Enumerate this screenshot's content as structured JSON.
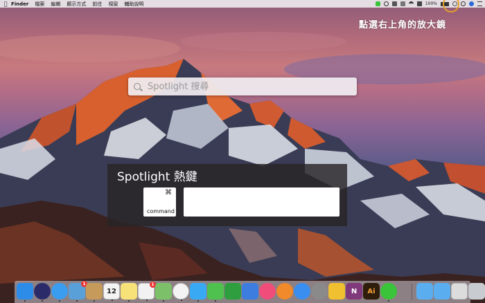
{
  "menubar": {
    "app_name": "Finder",
    "items": [
      "檔案",
      "編輯",
      "顯示方式",
      "前往",
      "視窗",
      "輔助說明"
    ],
    "battery": "100%"
  },
  "annotation": {
    "hint_text": "點選右上角的放大鏡",
    "highlight_color": "#e8a02a"
  },
  "spotlight": {
    "placeholder": "Spotlight 搜尋"
  },
  "hotkey_panel": {
    "title": "Spotlight 熱鍵",
    "key_symbol": "⌘",
    "key_label": "command",
    "field_value": ""
  },
  "dock": {
    "apps": [
      {
        "name": "finder",
        "color": "#2d8ce8"
      },
      {
        "name": "siri",
        "color": "#2b2b6a"
      },
      {
        "name": "safari",
        "color": "#3a9df0"
      },
      {
        "name": "preview",
        "color": "#5aa0d8",
        "badge": "1"
      },
      {
        "name": "contacts",
        "color": "#c59a5a"
      },
      {
        "name": "calendar",
        "color": "#f4f4f4",
        "text": "12"
      },
      {
        "name": "notes",
        "color": "#f7e27a"
      },
      {
        "name": "reminders",
        "color": "#f2f2f2",
        "badge": "1"
      },
      {
        "name": "maps",
        "color": "#7cc16a"
      },
      {
        "name": "photos",
        "color": "#f4f4f4"
      },
      {
        "name": "messages",
        "color": "#3aa9f4"
      },
      {
        "name": "facetime",
        "color": "#4fc14f"
      },
      {
        "name": "numbers",
        "color": "#2e9e3e"
      },
      {
        "name": "keynote",
        "color": "#3d7de0"
      },
      {
        "name": "itunes",
        "color": "#f04d7a"
      },
      {
        "name": "ibooks",
        "color": "#f08a2a"
      },
      {
        "name": "app-store",
        "color": "#3a8ef0"
      },
      {
        "name": "system-preferences",
        "color": "#8a8a8a"
      },
      {
        "name": "tes",
        "color": "#f0c030"
      },
      {
        "name": "onenote",
        "color": "#80397b",
        "text": "N"
      },
      {
        "name": "illustrator",
        "color": "#2d1d0a",
        "text": "Ai"
      },
      {
        "name": "line",
        "color": "#3ac43a"
      },
      {
        "name": "folder-applications",
        "color": "#5aaef0"
      },
      {
        "name": "folder-documents",
        "color": "#5aaef0"
      },
      {
        "name": "folder-downloads",
        "color": "#dcdcdc"
      },
      {
        "name": "trash",
        "color": "#c8ccd0"
      }
    ]
  }
}
